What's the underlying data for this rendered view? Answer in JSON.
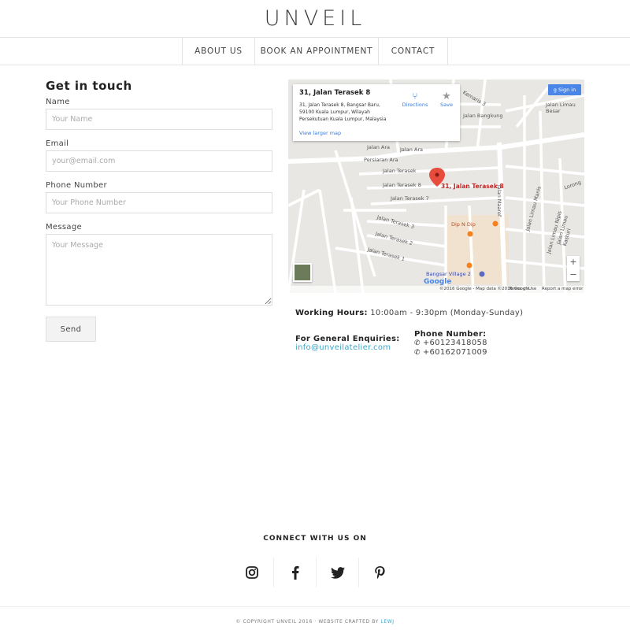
{
  "brand": {
    "logo": "UNVEIL"
  },
  "nav": {
    "items": [
      "ABOUT US",
      "BOOK AN APPOINTMENT",
      "CONTACT"
    ]
  },
  "form": {
    "title": "Get in touch",
    "name_label": "Name",
    "name_placeholder": "Your Name",
    "email_label": "Email",
    "email_placeholder": "your@email.com",
    "phone_label": "Phone Number",
    "phone_placeholder": "Your Phone Number",
    "message_label": "Message",
    "message_placeholder": "Your Message",
    "send_label": "Send"
  },
  "map": {
    "place_title": "31, Jalan Terasek 8",
    "address": "31, Jalan Terasek 8, Bangsar Baru, 59100 Kuala Lumpur, Wilayah Persekutuan Kuala Lumpur, Malaysia",
    "view_larger": "View larger map",
    "directions": "Directions",
    "save": "Save",
    "sign_in": "Sign in",
    "marker_label": "31, Jalan Terasek 8",
    "zoom_in": "+",
    "zoom_out": "−",
    "copyright": "©2016 Google - Map data ©2016 Google",
    "terms": "Terms of Use",
    "report": "Report a map error",
    "google": "Google",
    "streets": {
      "kemaris_3": "Kemaris 3",
      "jalan_bangkung": "Jalan Bangkung",
      "jalan_limau_besar": "Jalan Limau Besar",
      "jalan_ara_1": "Jalan Ara",
      "jalan_ara_2": "Jalan Ara",
      "persiaran_ara": "Persiaran Ara",
      "jalan_terasek_top": "Jalan Terasek",
      "jalan_terasek_8": "Jalan Terasek 8",
      "jalan_terasek_7": "Jalan Terasek 7",
      "jalan_terasek_3": "Jalan Terasek 3",
      "jalan_terasek_2": "Jalan Terasek 2",
      "jalan_terasek_1": "Jalan Terasek 1",
      "jalan_maarof": "Jalan Maarof",
      "dip_n_dip": "Dip N Dip",
      "bangsar_village": "Bangsar Village 2",
      "jalan_limau_manis": "Jalan Limau Manis",
      "jalan_limau_nipis": "Jalan Limau Nipis",
      "jalan_limau_kasturi": "Jalan Limau Kasturi",
      "lorong": "Lorong"
    }
  },
  "info": {
    "hours_label": "Working Hours:",
    "hours_value": "10:00am - 9:30pm (Monday-Sunday)",
    "enquiries_label": "For General Enquiries:",
    "enquiries_email": "info@unveilatelier.com",
    "phone_label": "Phone Number:",
    "phones": [
      "+60123418058",
      "+60162071009"
    ]
  },
  "social": {
    "title": "CONNECT WITH US ON",
    "icons": [
      "instagram-icon",
      "facebook-icon",
      "twitter-icon",
      "pinterest-icon"
    ]
  },
  "footer": {
    "copyright": "© COPYRIGHT UNVEIL 2016 · WEBSITE CRAFTED BY",
    "credit": "LEWJ"
  }
}
